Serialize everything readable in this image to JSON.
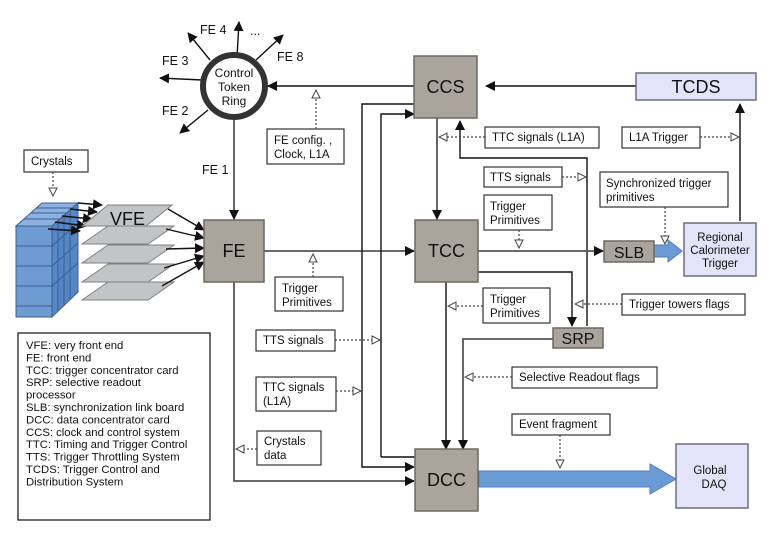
{
  "blocks": {
    "ccs": "CCS",
    "tcds": "TCDS",
    "fe": "FE",
    "vfe": "VFE",
    "tcc": "TCC",
    "slb": "SLB",
    "srp": "SRP",
    "dcc": "DCC",
    "rct": [
      "Regional",
      "Calorimeter",
      "Trigger"
    ],
    "daq": [
      "Global",
      "DAQ"
    ],
    "ring": [
      "Control",
      "Token",
      "Ring"
    ]
  },
  "ring_outputs": {
    "fe1": "FE 1",
    "fe2": "FE 2",
    "fe3": "FE 3",
    "fe4": "FE 4",
    "dots": "...",
    "fe8": "FE 8"
  },
  "labels": {
    "crystals": "Crystals",
    "fe_config": [
      "FE config. ,",
      "Clock, L1A"
    ],
    "ttc_signals_ccs": "TTC signals (L1A)",
    "l1a_trigger": "L1A Trigger",
    "tts_signals_top": "TTS signals",
    "sync_trigger_primitives": [
      "Synchronized trigger",
      "primitives"
    ],
    "trigger_primitives_tcc_in": [
      "Trigger",
      "Primitives"
    ],
    "trigger_primitives_fe": [
      "Trigger",
      "Primitives"
    ],
    "trigger_primitives_tcc_out": [
      "Trigger",
      "Primitives"
    ],
    "trigger_towers_flags": "Trigger towers flags",
    "tts_signals_bottom": "TTS signals",
    "ttc_signals_bottom": [
      "TTC signals",
      "(L1A)"
    ],
    "crystals_data": [
      "Crystals",
      "data"
    ],
    "selective_readout_flags": "Selective Readout flags",
    "event_fragment": "Event fragment"
  },
  "legend": [
    "VFE: very front end",
    "FE: front end",
    "TCC: trigger concentrator card",
    "SRP: selective readout",
    "processor",
    "SLB: synchronization link board",
    "DCC: data concentrator card",
    "CCS: clock and control system",
    "TTC: Timing and Trigger Control",
    "TTS: Trigger Throttling System",
    "TCDS: Trigger Control and",
    "Distribution System"
  ],
  "colors": {
    "block": "#aba49c",
    "external": "#e3e4f9",
    "data_path": "#6a9bd4"
  }
}
